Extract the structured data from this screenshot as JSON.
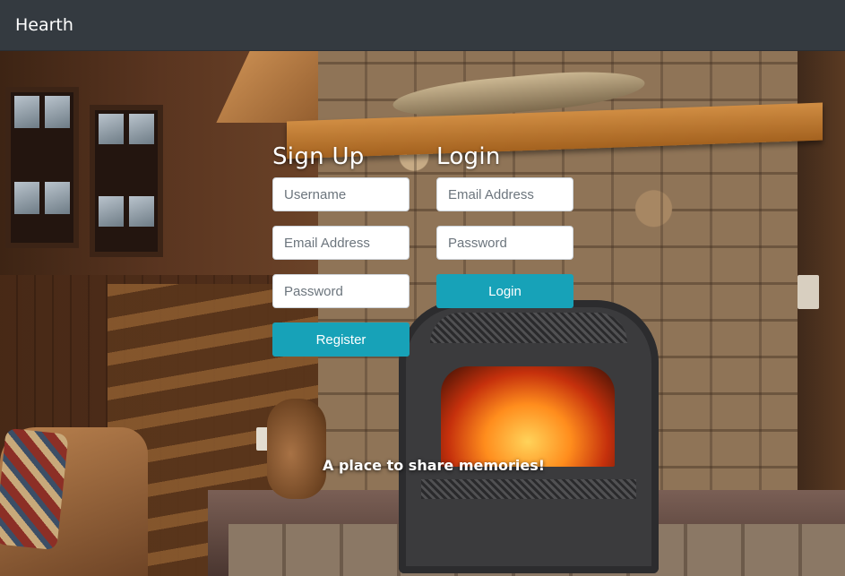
{
  "app": {
    "brand": "Hearth"
  },
  "signup": {
    "title": "Sign Up",
    "username_placeholder": "Username",
    "email_placeholder": "Email Address",
    "password_placeholder": "Password",
    "submit_label": "Register"
  },
  "login": {
    "title": "Login",
    "email_placeholder": "Email Address",
    "password_placeholder": "Password",
    "submit_label": "Login"
  },
  "hero": {
    "tagline": "A place to share memories!"
  },
  "colors": {
    "navbar": "#343a40",
    "accent": "#17a2b8",
    "text_light": "#ffffff"
  }
}
